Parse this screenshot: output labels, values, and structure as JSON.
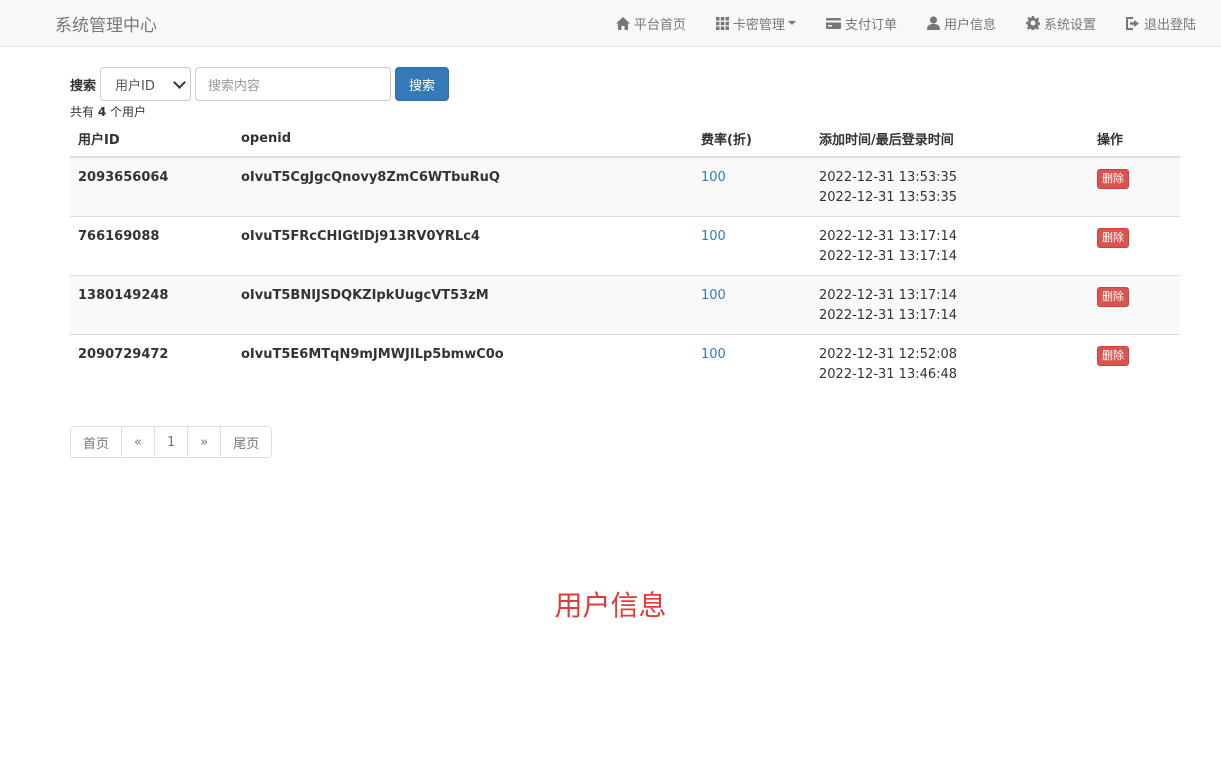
{
  "navbar": {
    "brand": "系统管理中心",
    "items": [
      {
        "label": "平台首页",
        "icon": "home-icon"
      },
      {
        "label": "卡密管理",
        "icon": "grid-icon",
        "dropdown": true
      },
      {
        "label": "支付订单",
        "icon": "credit-card-icon"
      },
      {
        "label": "用户信息",
        "icon": "user-icon"
      },
      {
        "label": "系统设置",
        "icon": "gear-icon"
      },
      {
        "label": "退出登陆",
        "icon": "logout-icon"
      }
    ]
  },
  "search": {
    "label": "搜索",
    "field_selected": "用户ID",
    "placeholder": "搜索内容",
    "button": "搜索"
  },
  "summary": {
    "prefix": "共有 ",
    "count": "4",
    "suffix": " 个用户"
  },
  "table": {
    "headers": [
      "用户ID",
      "openid",
      "费率(折)",
      "添加时间/最后登录时间",
      "操作"
    ],
    "rows": [
      {
        "id": "2093656064",
        "openid": "oIvuT5CgJgcQnovy8ZmC6WTbuRuQ",
        "rate": "100",
        "added": "2022-12-31 13:53:35",
        "last_login": "2022-12-31 13:53:35",
        "action": "删除"
      },
      {
        "id": "766169088",
        "openid": "oIvuT5FRcCHIGtIDj913RV0YRLc4",
        "rate": "100",
        "added": "2022-12-31 13:17:14",
        "last_login": "2022-12-31 13:17:14",
        "action": "删除"
      },
      {
        "id": "1380149248",
        "openid": "oIvuT5BNIJSDQKZIpkUugcVT53zM",
        "rate": "100",
        "added": "2022-12-31 13:17:14",
        "last_login": "2022-12-31 13:17:14",
        "action": "删除"
      },
      {
        "id": "2090729472",
        "openid": "oIvuT5E6MTqN9mJMWJILp5bmwC0o",
        "rate": "100",
        "added": "2022-12-31 12:52:08",
        "last_login": "2022-12-31 13:46:48",
        "action": "删除"
      }
    ]
  },
  "pagination": [
    "首页",
    "«",
    "1",
    "»",
    "尾页"
  ],
  "footer_title": "用户信息",
  "colors": {
    "primary": "#337ab7",
    "danger": "#d9534f",
    "footer_title": "#e03a3a"
  }
}
